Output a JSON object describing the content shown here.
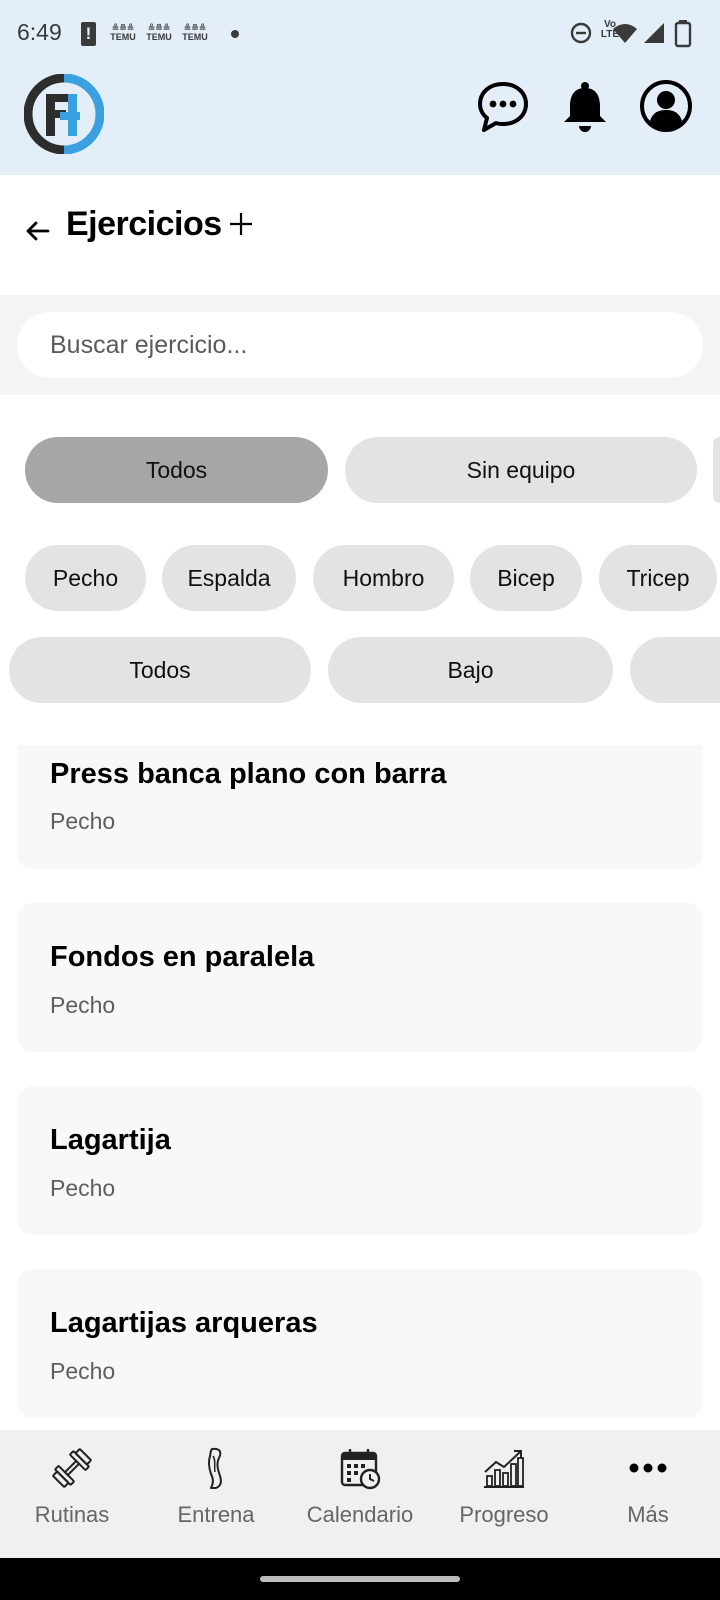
{
  "status_bar": {
    "time": "6:49",
    "alert_glyph": "!",
    "temu_labels": [
      "TEMU",
      "TEMU",
      "TEMU"
    ],
    "volte": "Vo LTE",
    "icons": [
      "dnd-icon",
      "volte-icon",
      "wifi-icon",
      "signal-icon",
      "battery-icon"
    ]
  },
  "header": {
    "logo": "fh-logo",
    "icons": [
      "chat-icon",
      "bell-icon",
      "profile-icon"
    ],
    "colors": {
      "logo_dark": "#2d2d2d",
      "logo_blue": "#3aa0e0",
      "background": "#e3eef9"
    }
  },
  "page": {
    "title": "Ejercicios",
    "back_icon": "back-arrow-icon",
    "add_icon": "plus-icon"
  },
  "search": {
    "placeholder": "Buscar ejercicio...",
    "value": ""
  },
  "filters": {
    "equipment": [
      {
        "label": "Todos",
        "selected": true
      },
      {
        "label": "Sin equipo",
        "selected": false
      },
      {
        "label": "",
        "selected": false
      }
    ],
    "muscles": [
      {
        "label": "Pecho"
      },
      {
        "label": "Espalda"
      },
      {
        "label": "Hombro"
      },
      {
        "label": "Bicep"
      },
      {
        "label": "Tricep"
      }
    ],
    "levels": [
      {
        "label": "Todos"
      },
      {
        "label": "Bajo"
      },
      {
        "label": ""
      }
    ]
  },
  "exercises": [
    {
      "name": "Press banca plano con barra",
      "category": "Pecho"
    },
    {
      "name": "Fondos en paralela",
      "category": "Pecho"
    },
    {
      "name": "Lagartija",
      "category": "Pecho"
    },
    {
      "name": "Lagartijas arqueras",
      "category": "Pecho"
    }
  ],
  "bottom_nav": [
    {
      "label": "Rutinas",
      "icon": "dumbbell-icon"
    },
    {
      "label": "Entrena",
      "icon": "leg-icon"
    },
    {
      "label": "Calendario",
      "icon": "calendar-icon"
    },
    {
      "label": "Progreso",
      "icon": "chart-icon"
    },
    {
      "label": "Más",
      "icon": "more-icon"
    }
  ]
}
